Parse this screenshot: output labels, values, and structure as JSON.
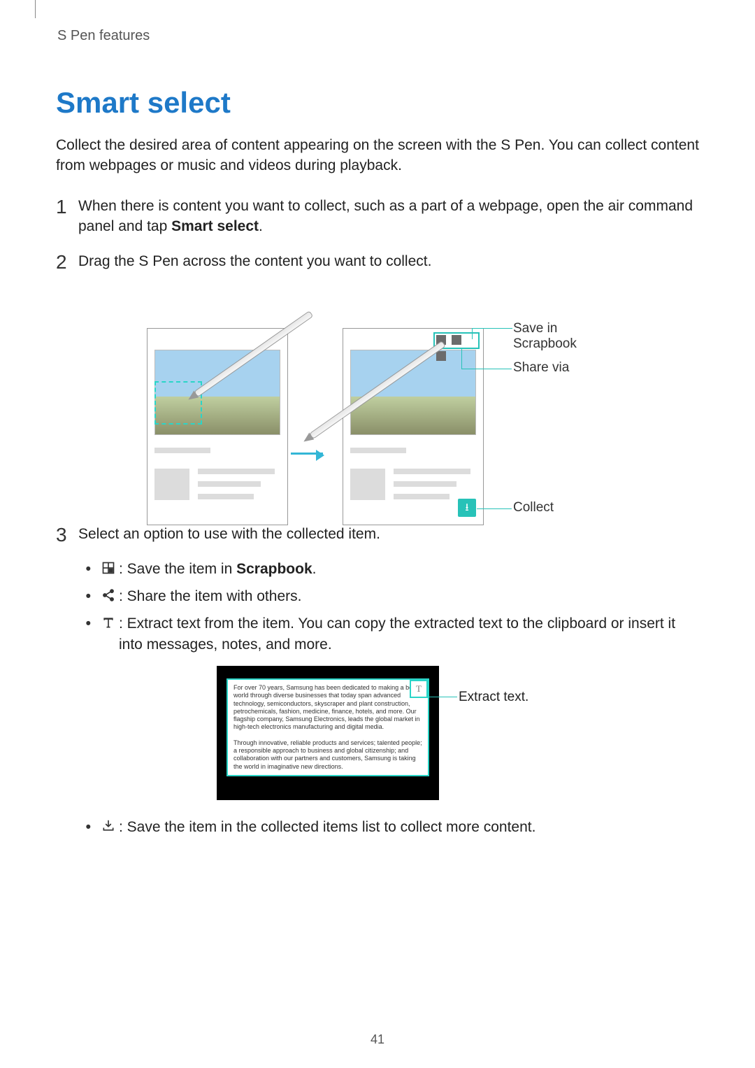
{
  "header": "S Pen features",
  "title": "Smart select",
  "intro": "Collect the desired area of content appearing on the screen with the S Pen. You can collect content from webpages or music and videos during playback.",
  "steps": [
    {
      "num": "1",
      "pre": "When there is content you want to collect, such as a part of a webpage, open the air command panel and tap ",
      "bold": "Smart select",
      "post": "."
    },
    {
      "num": "2",
      "text": "Drag the S Pen across the content you want to collect."
    },
    {
      "num": "3",
      "text": "Select an option to use with the collected item."
    }
  ],
  "callouts": {
    "scrapbook": "Save in Scrapbook",
    "share": "Share via",
    "collect": "Collect",
    "extract": "Extract text."
  },
  "bullets": {
    "scrapbook_pre": " : Save the item in ",
    "scrapbook_bold": "Scrapbook",
    "scrapbook_post": ".",
    "share": " : Share the item with others.",
    "extract": " : Extract text from the item. You can copy the extracted text to the clipboard or insert it into messages, notes, and more.",
    "collect": " : Save the item in the collected items list to collect more content."
  },
  "fig2": {
    "t_label": "T",
    "p1": "For over 70 years, Samsung has been dedicated to making a better world through diverse businesses that today span advanced technology, semiconductors, skyscraper and plant construction, petrochemicals, fashion, medicine, finance, hotels, and more. Our flagship company, Samsung Electronics, leads the global market in high-tech electronics manufacturing and digital media.",
    "p2": "Through innovative, reliable products and services; talented people; a responsible approach to business and global citizenship; and collaboration with our partners and customers, Samsung is taking the world in imaginative new directions."
  },
  "page_number": "41"
}
